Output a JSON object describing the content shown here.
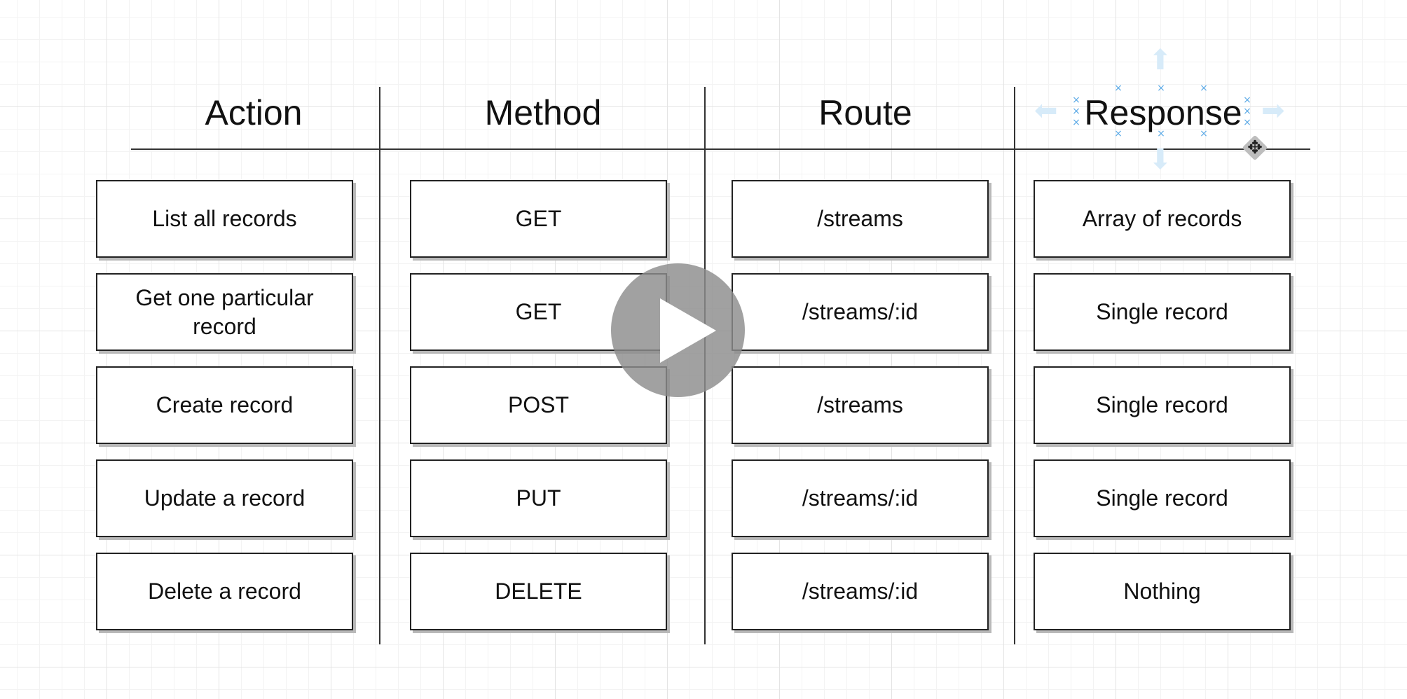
{
  "headers": {
    "action": "Action",
    "method": "Method",
    "route": "Route",
    "response": "Response"
  },
  "rows": [
    {
      "action": "List all records",
      "method": "GET",
      "route": "/streams",
      "response": "Array of records"
    },
    {
      "action": "Get one particular record",
      "method": "GET",
      "route": "/streams/:id",
      "response": "Single record"
    },
    {
      "action": "Create record",
      "method": "POST",
      "route": "/streams",
      "response": "Single record"
    },
    {
      "action": "Update a record",
      "method": "PUT",
      "route": "/streams/:id",
      "response": "Single record"
    },
    {
      "action": "Delete a record",
      "method": "DELETE",
      "route": "/streams/:id",
      "response": "Nothing"
    }
  ],
  "overlay": {
    "play_icon": "play-icon",
    "move_cursor_icon": "move-cursor-icon",
    "selected_element": "Response"
  },
  "colors": {
    "selection": "#5aa9e6",
    "play_button": "#8c8c8c"
  }
}
